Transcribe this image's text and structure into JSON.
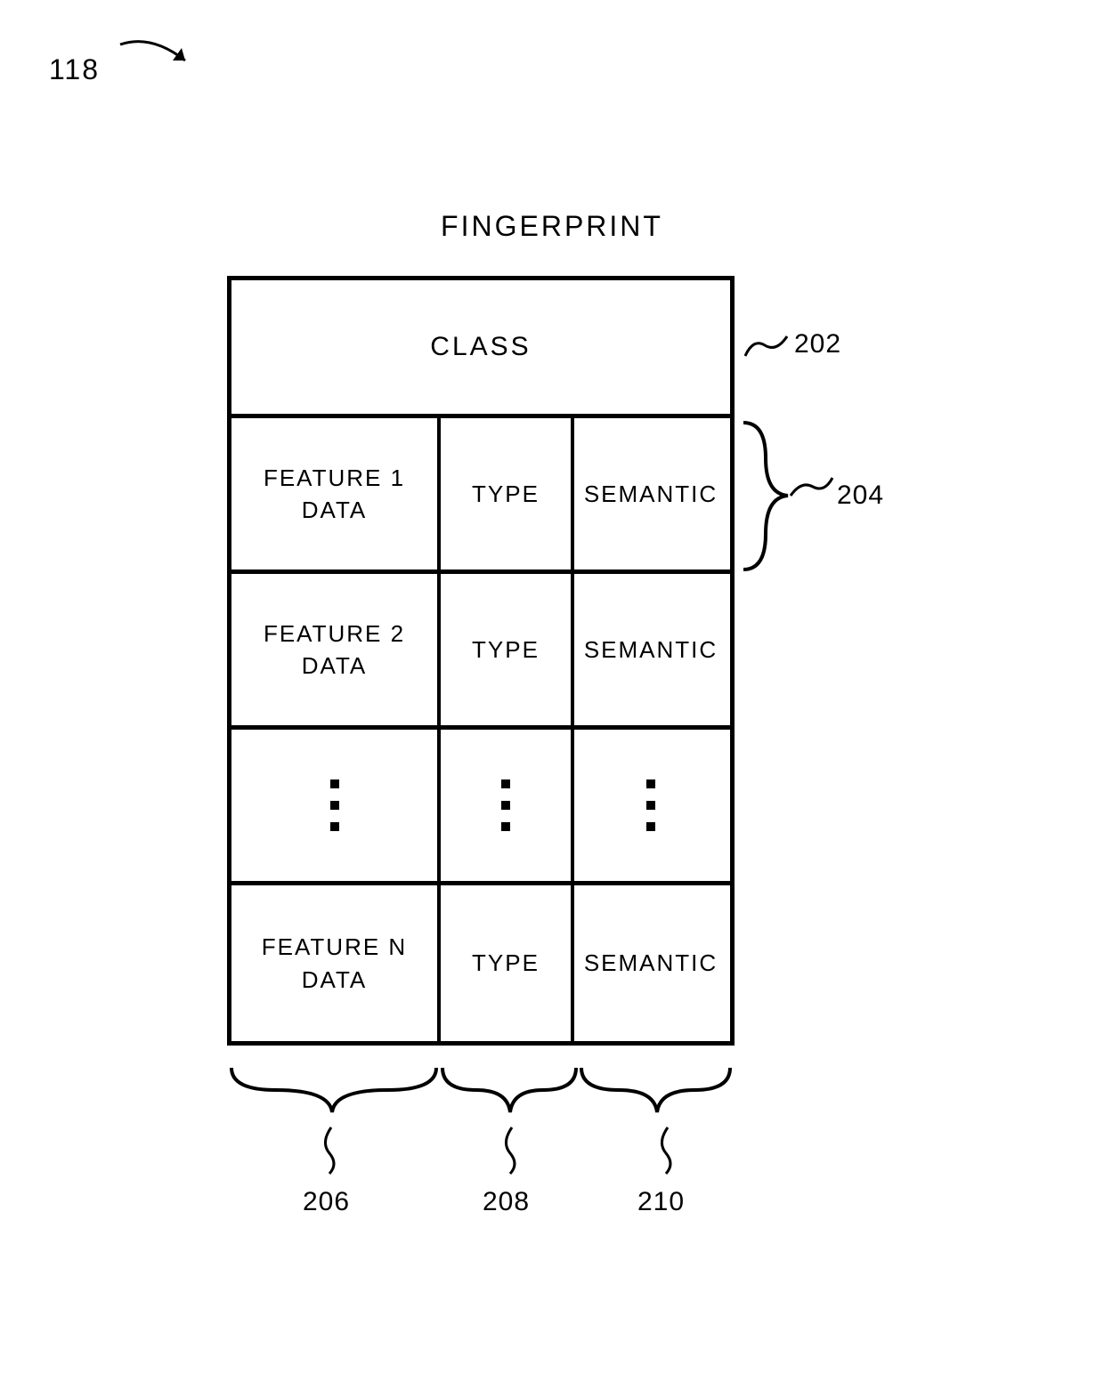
{
  "figure_number": "118",
  "title": "FINGERPRINT",
  "table": {
    "class_label": "CLASS",
    "rows": [
      {
        "data": "FEATURE 1\nDATA",
        "type": "TYPE",
        "semantic": "SEMANTIC"
      },
      {
        "data": "FEATURE 2\nDATA",
        "type": "TYPE",
        "semantic": "SEMANTIC"
      },
      {
        "data": "FEATURE N\nDATA",
        "type": "TYPE",
        "semantic": "SEMANTIC"
      }
    ]
  },
  "refs": {
    "class_row": "202",
    "feature_row": "204",
    "col_data": "206",
    "col_type": "208",
    "col_semantic": "210"
  }
}
